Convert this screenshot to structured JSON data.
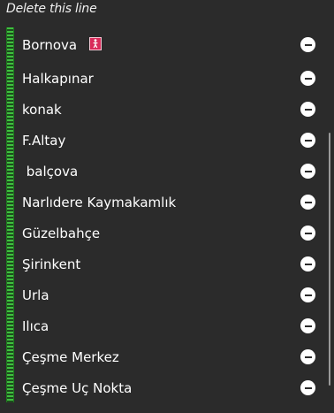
{
  "header": {
    "title": "Delete this line"
  },
  "line": {
    "color": "#3fbf3f"
  },
  "stops": [
    {
      "name": "Bornova",
      "badge": "accessible-icon"
    },
    {
      "name": "Halkapınar"
    },
    {
      "name": "konak"
    },
    {
      "name": "F.Altay"
    },
    {
      "name": " balçova"
    },
    {
      "name": "Narlıdere Kaymakamlık"
    },
    {
      "name": "Güzelbahçe"
    },
    {
      "name": "Şirinkent"
    },
    {
      "name": "Urla"
    },
    {
      "name": "Ilıca"
    },
    {
      "name": "Çeşme Merkez"
    },
    {
      "name": "Çeşme Uç Nokta"
    }
  ],
  "icons": {
    "remove": "minus-circle-icon",
    "accessible": "accessible-icon"
  }
}
